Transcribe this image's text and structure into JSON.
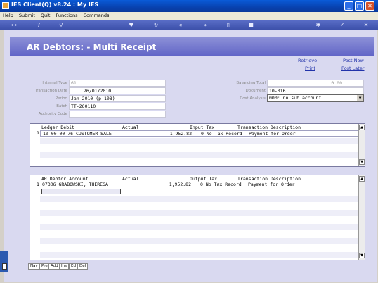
{
  "window": {
    "title": "IES Client(Q) v8.24 : My IES"
  },
  "menu": [
    "Help",
    "Submit",
    "Quit",
    "Functions",
    "Commands"
  ],
  "toolbar_icons": [
    "key-icon",
    "help-icon",
    "search-icon",
    "heart-icon",
    "refresh-icon",
    "rewind-icon",
    "forward-icon",
    "document-icon",
    "stop-icon",
    "gear-icon",
    "check-icon",
    "close-icon"
  ],
  "header": {
    "title": "AR Debtors: - Multi Receipt"
  },
  "actions": {
    "retrieve": "Retrieve",
    "print": "Print",
    "post_now": "Post Now",
    "post_later": "Post Later"
  },
  "form_left": {
    "internal_type_label": "Internal Type",
    "internal_type": "61",
    "transaction_date_label": "Transaction Date",
    "transaction_date": "26/01/2010",
    "period_label": "Period",
    "period": "Jan 2010 (p 108)",
    "batch_label": "Batch",
    "batch": "TT-260110",
    "authority_code_label": "Authority Code",
    "authority_code": ""
  },
  "form_right": {
    "balancing_total_label": "Balancing Total",
    "balancing_total": "0.00",
    "document_label": "Document",
    "document": "10-016",
    "cost_analysis_label": "Cost Analysis",
    "cost_analysis": "000: no sub account"
  },
  "ledger_grid": {
    "columns": [
      "Ledger Debit",
      "Actual",
      "Input Tax",
      "Transaction Description"
    ],
    "rows": [
      {
        "no": "1",
        "account": "10-00-00-76 CUSTOMER SALE",
        "actual": "1,952.82",
        "tax": "0 No Tax Record",
        "desc": "Payment for Order"
      }
    ]
  },
  "debtor_grid": {
    "columns": [
      "AR Debtor Account",
      "Actual",
      "Output Tax",
      "Transaction Description"
    ],
    "rows": [
      {
        "no": "1",
        "account": "07306 GRABOWSKI, THERESA",
        "actual": "1,952.82",
        "tax": "0 No Tax Record",
        "desc": "Payment for Order"
      }
    ]
  },
  "nav_buttons": [
    "Nav",
    "Pre",
    "Add",
    "Ins",
    "Ed",
    "Del"
  ],
  "colors": {
    "title_bar": "#0842b0",
    "header": "#7074cc",
    "content_bg": "#d9d9f0",
    "link": "#2233aa"
  }
}
